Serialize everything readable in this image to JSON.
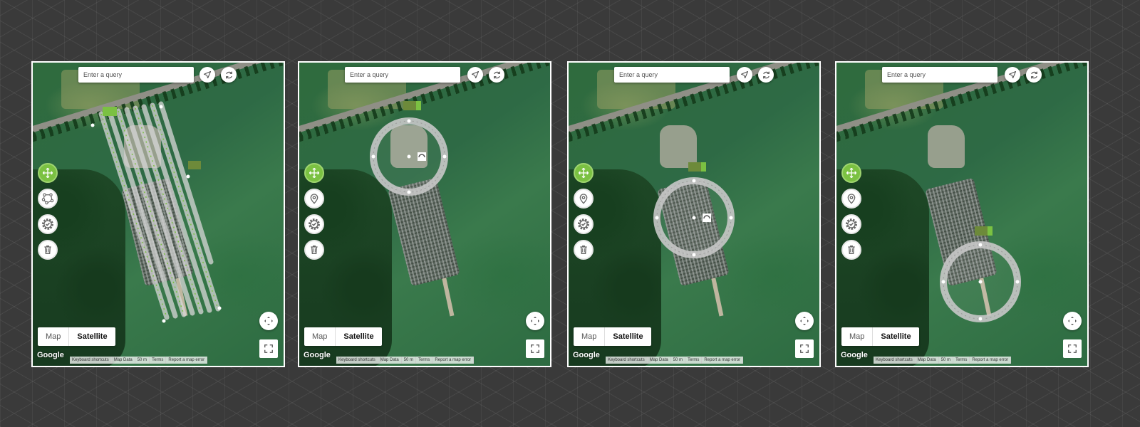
{
  "panels": [
    {
      "id": "panel-1",
      "mode": "survey-grid",
      "second_tool_icon": "polygon-icon"
    },
    {
      "id": "panel-2",
      "mode": "orbit",
      "second_tool_icon": "location-pin-icon"
    },
    {
      "id": "panel-3",
      "mode": "orbit",
      "second_tool_icon": "location-pin-icon"
    },
    {
      "id": "panel-4",
      "mode": "orbit",
      "second_tool_icon": "location-pin-icon"
    }
  ],
  "search": {
    "placeholder": "Enter a query"
  },
  "maptype": {
    "map_label": "Map",
    "satellite_label": "Satellite",
    "selected": "Satellite"
  },
  "branding": {
    "logo_text": "Google"
  },
  "footer": {
    "keyboard": "Keyboard shortcuts",
    "map_data": "Map Data",
    "scale": "50 m",
    "terms": "Terms",
    "report": "Report a map error"
  },
  "colors": {
    "accent_green": "#7bc142",
    "orbit_ring": "#c8c8c8",
    "panel_border": "#ffffff"
  }
}
